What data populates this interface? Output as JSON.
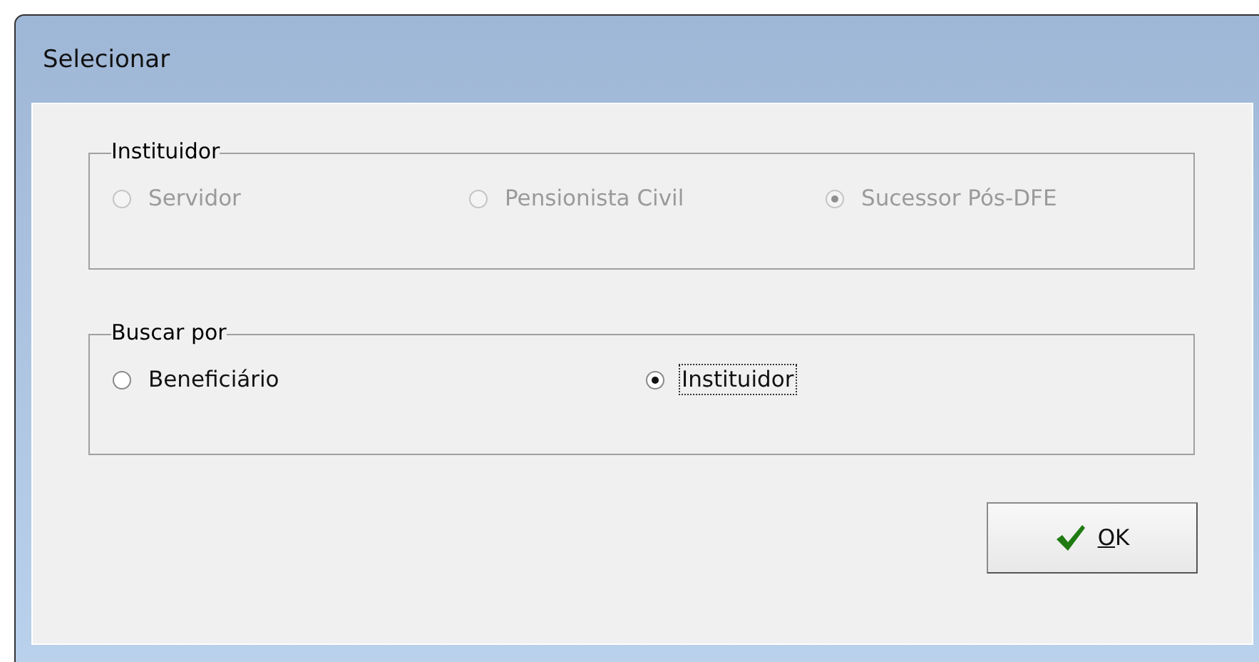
{
  "window": {
    "title": "Selecionar"
  },
  "groups": [
    {
      "title": "Instituidor",
      "options": [
        {
          "label": "Servidor",
          "selected": false,
          "disabled": true,
          "focused": false
        },
        {
          "label": "Pensionista Civil",
          "selected": false,
          "disabled": true,
          "focused": false
        },
        {
          "label": "Sucessor Pós-DFE",
          "selected": true,
          "disabled": true,
          "focused": false
        }
      ]
    },
    {
      "title": "Buscar por",
      "options": [
        {
          "label": "Beneficiário",
          "selected": false,
          "disabled": false,
          "focused": false
        },
        {
          "label": "Instituidor",
          "selected": true,
          "disabled": false,
          "focused": true
        }
      ]
    }
  ],
  "buttons": [
    {
      "label": "OK"
    }
  ]
}
